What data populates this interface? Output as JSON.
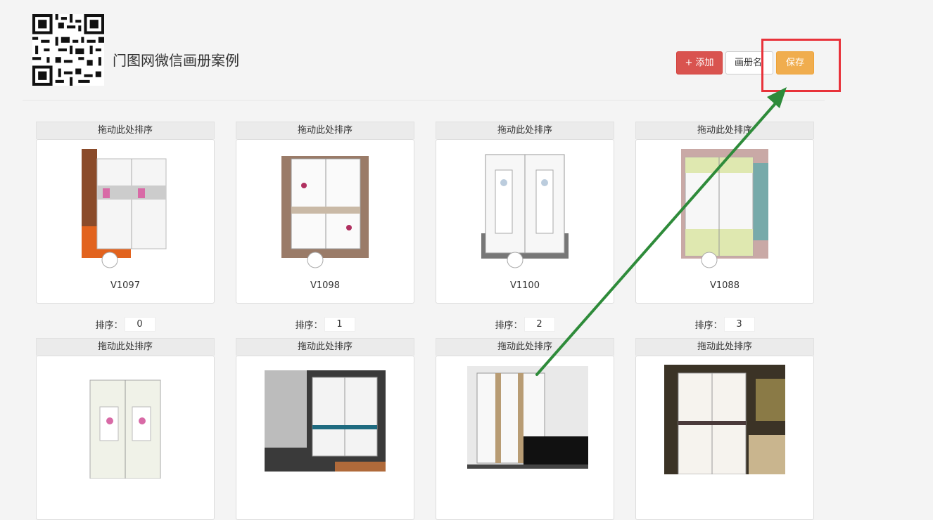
{
  "header": {
    "title": "门图网微信画册案例",
    "buttons": {
      "add": "+ 添加",
      "name": "画册名",
      "save": "保存"
    }
  },
  "card_drag_label": "拖动此处排序",
  "sort_label": "排序：",
  "cards": [
    {
      "name": "V1097",
      "sort": "0"
    },
    {
      "name": "V1098",
      "sort": "1"
    },
    {
      "name": "V1100",
      "sort": "2"
    },
    {
      "name": "V1088",
      "sort": "3"
    },
    {
      "name": ""
    },
    {
      "name": ""
    },
    {
      "name": ""
    },
    {
      "name": ""
    }
  ],
  "annotation": {
    "box_color": "#e8323a",
    "arrow_color": "#2e8b3a"
  },
  "colors": {
    "add_button": "#d9534f",
    "save_button": "#f0ad4e"
  }
}
